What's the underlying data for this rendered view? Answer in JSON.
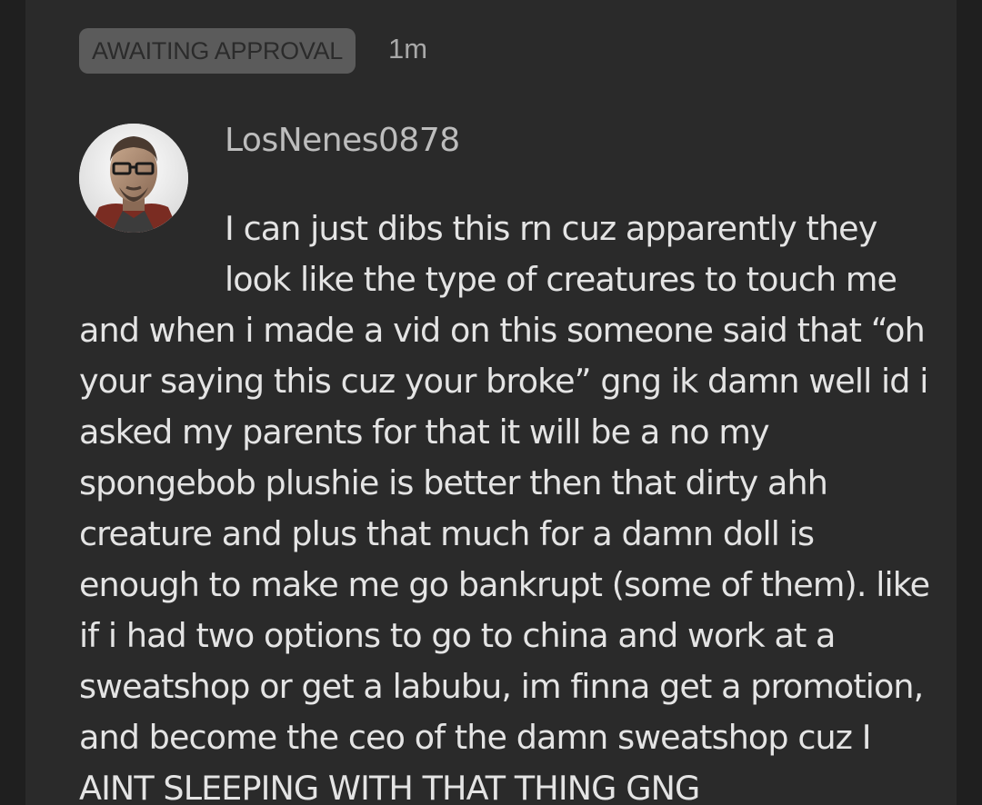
{
  "post": {
    "status_badge": "AWAITING APPROVAL",
    "timestamp": "1m",
    "author": {
      "username": "LosNenes0878",
      "avatar_icon": "user-avatar"
    },
    "comment_lines": [
      "I can just dibs this rn cuz apparently they",
      "look like the type of creatures to touch me",
      "and when i made a vid on this someone said that “oh",
      "your saying this cuz your broke” gng ik damn well id i",
      "asked my parents for that it will be a no my",
      "spongebob plushie is better then that dirty ahh",
      "creature and plus that much for a damn doll is",
      "enough to make me go bankrupt (some of them). like",
      "if i had two options to go to china and work at a",
      "sweatshop or get a labubu, im finna get a promotion,",
      "and become the ceo of the damn sweatshop cuz I",
      "AINT SLEEPING WITH THAT THING GNG"
    ]
  },
  "colors": {
    "background": "#1f1f1f",
    "card": "#2a2a2a",
    "badge_bg": "#5b5b5b",
    "text": "#e4e4e4",
    "username": "#bdbdbd",
    "muted": "#a8a8a8"
  }
}
